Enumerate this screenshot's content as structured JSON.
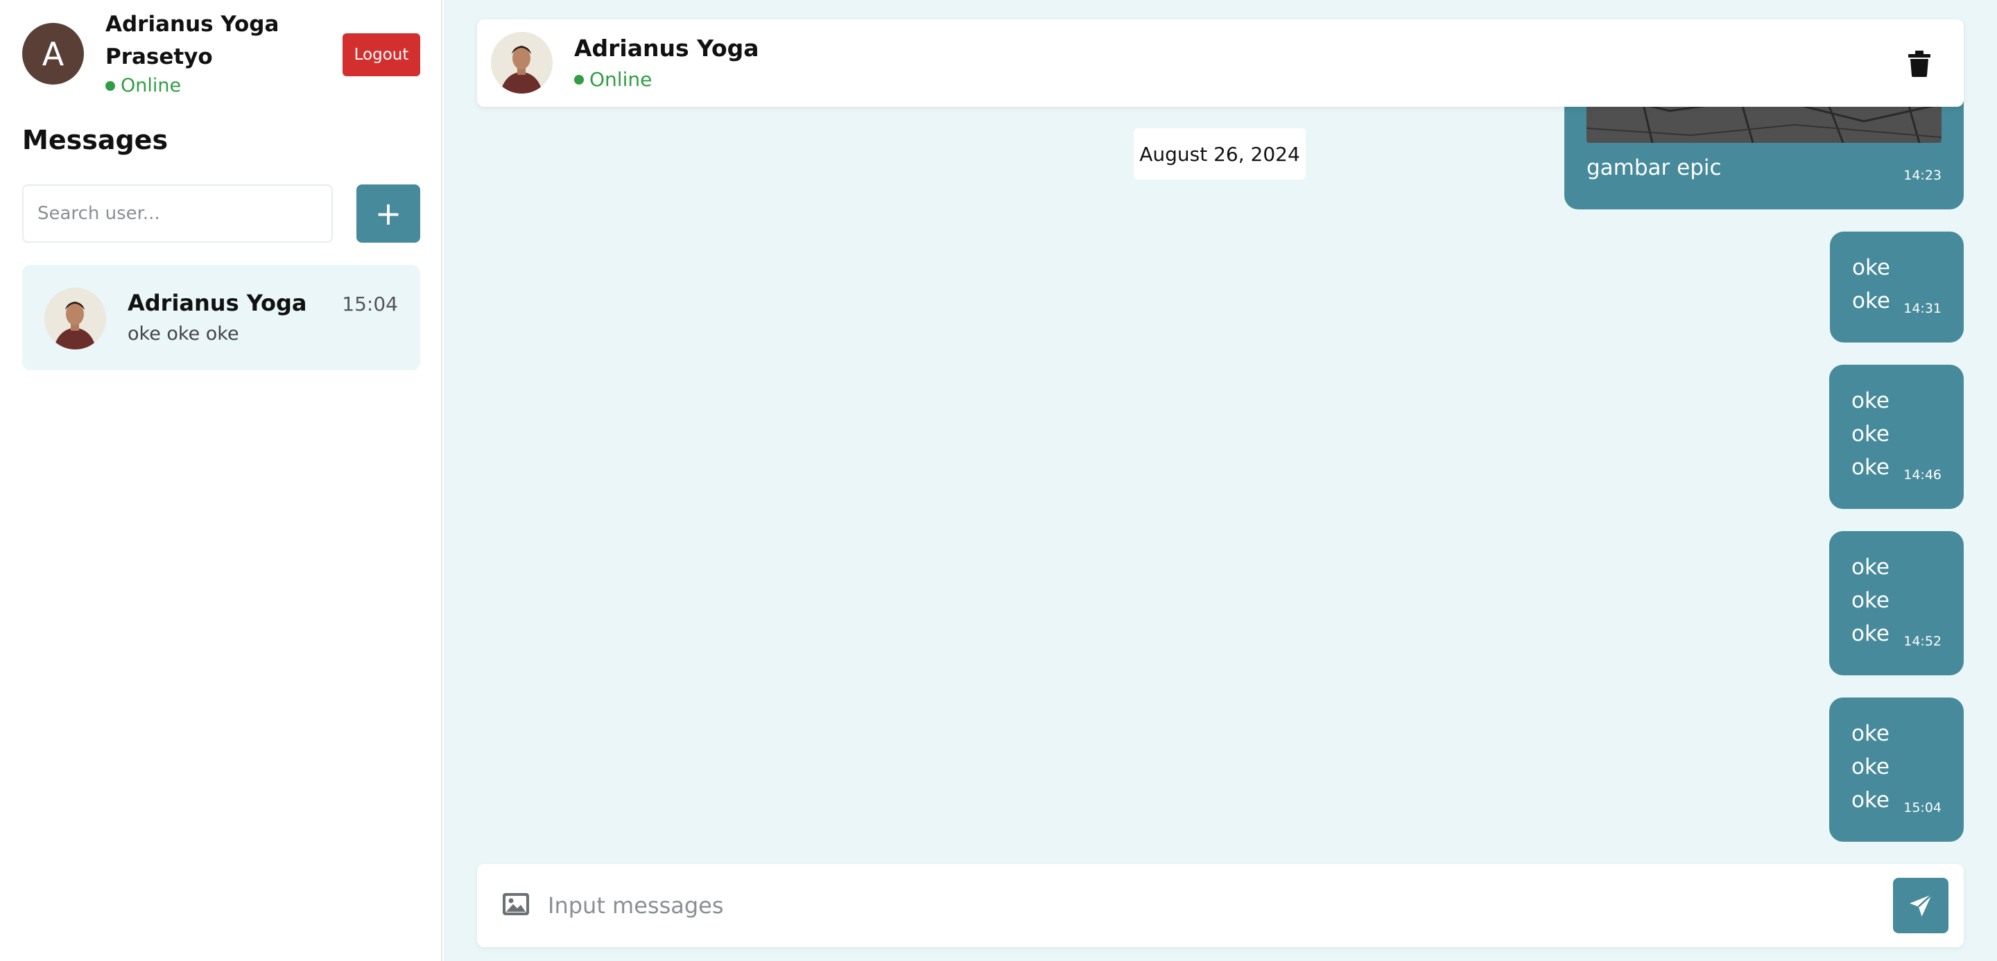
{
  "current_user": {
    "avatar_initial": "A",
    "name": "Adrianus Yoga Prasetyo",
    "status": "Online",
    "logout_label": "Logout"
  },
  "sidebar": {
    "title": "Messages",
    "search_placeholder": "Search user...",
    "add_label": "+",
    "conversations": [
      {
        "name": "Adrianus Yoga",
        "preview": "oke oke oke",
        "time": "15:04"
      }
    ]
  },
  "chat": {
    "header": {
      "name": "Adrianus Yoga",
      "status": "Online"
    },
    "date_separator": "August 26, 2024",
    "messages": [
      {
        "type": "image",
        "caption": "gambar epic",
        "time": "14:23"
      },
      {
        "type": "text",
        "lines": [
          "oke",
          "oke"
        ],
        "time": "14:31"
      },
      {
        "type": "text",
        "lines": [
          "oke",
          "oke",
          "oke"
        ],
        "time": "14:46"
      },
      {
        "type": "text",
        "lines": [
          "oke",
          "oke",
          "oke"
        ],
        "time": "14:52"
      },
      {
        "type": "text",
        "lines": [
          "oke",
          "oke",
          "oke"
        ],
        "time": "15:04"
      }
    ],
    "composer_placeholder": "Input messages"
  },
  "colors": {
    "accent": "#468a9b",
    "online": "#2f9e44",
    "logout": "#d32f2f",
    "chat_bg": "#eaf6f8"
  },
  "icons": [
    "plus-icon",
    "trash-icon",
    "image-icon",
    "send-icon",
    "online-dot"
  ]
}
